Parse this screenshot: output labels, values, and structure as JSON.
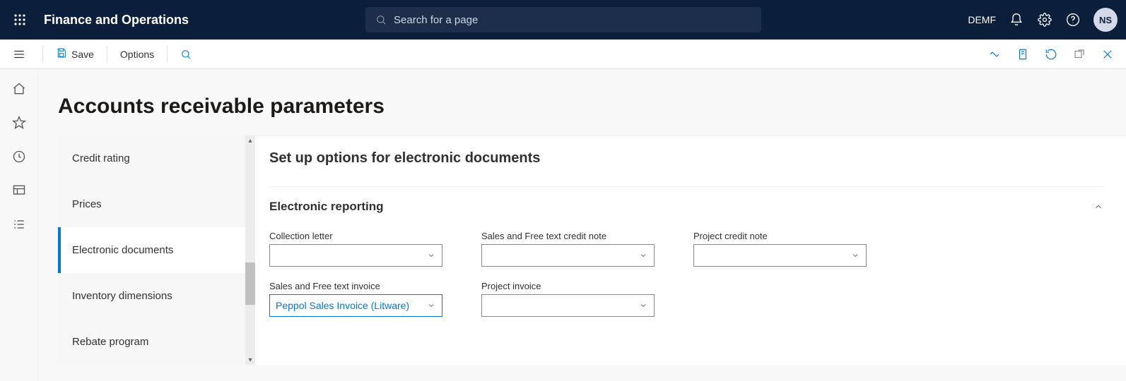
{
  "header": {
    "app_title": "Finance and Operations",
    "search_placeholder": "Search for a page",
    "company": "DEMF",
    "avatar_initials": "NS"
  },
  "actionbar": {
    "save_label": "Save",
    "options_label": "Options"
  },
  "page": {
    "title": "Accounts receivable parameters"
  },
  "sidenav": {
    "items": [
      {
        "label": "Credit rating"
      },
      {
        "label": "Prices"
      },
      {
        "label": "Electronic documents"
      },
      {
        "label": "Inventory dimensions"
      },
      {
        "label": "Rebate program"
      }
    ],
    "active_index": 2
  },
  "form": {
    "section_title": "Set up options for electronic documents",
    "subsection_title": "Electronic reporting",
    "fields": {
      "collection_letter": {
        "label": "Collection letter",
        "value": ""
      },
      "sales_credit_note": {
        "label": "Sales and Free text credit note",
        "value": ""
      },
      "project_credit_note": {
        "label": "Project credit note",
        "value": ""
      },
      "sales_invoice": {
        "label": "Sales and Free text invoice",
        "value": "Peppol Sales Invoice (Litware)"
      },
      "project_invoice": {
        "label": "Project invoice",
        "value": ""
      }
    }
  }
}
